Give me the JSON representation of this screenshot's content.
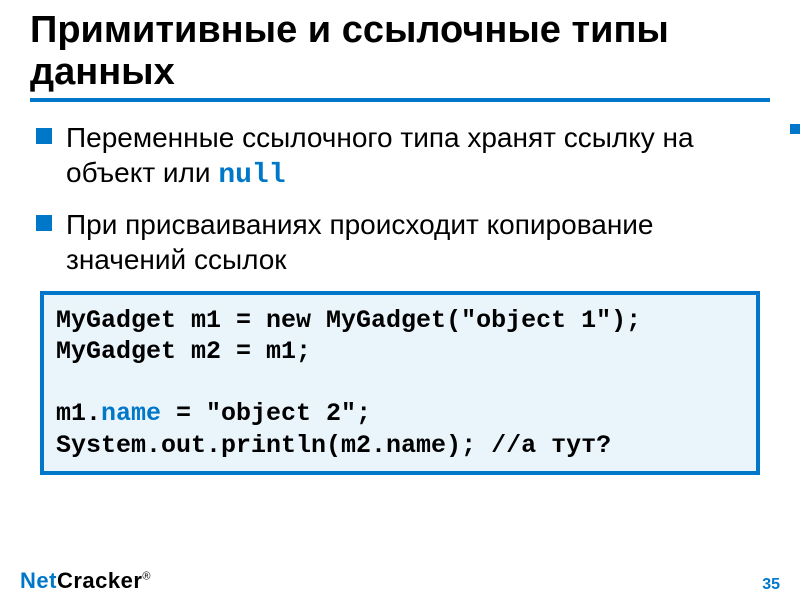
{
  "slide": {
    "title": "Примитивные и ссылочные типы данных",
    "bullets": [
      {
        "pre": "Переменные ссылочного типа хранят ссылку на объект или ",
        "mono": "null",
        "post": ""
      },
      {
        "pre": "При присваиваниях происходит копирование значений ссылок",
        "mono": "",
        "post": ""
      }
    ],
    "code": {
      "l1a": "MyGadget m1 = new MyGadget(\"object 1\");",
      "l2": "MyGadget m2 = m1;",
      "blank": "",
      "l3a": "m1.",
      "l3b": "name",
      "l3c": " = \"object 2\";",
      "l4": "System.out.println(m2.name); //а тут?"
    }
  },
  "footer": {
    "logo_net": "Net",
    "logo_cracker": "Cracker",
    "reg": "®",
    "page": "35"
  }
}
